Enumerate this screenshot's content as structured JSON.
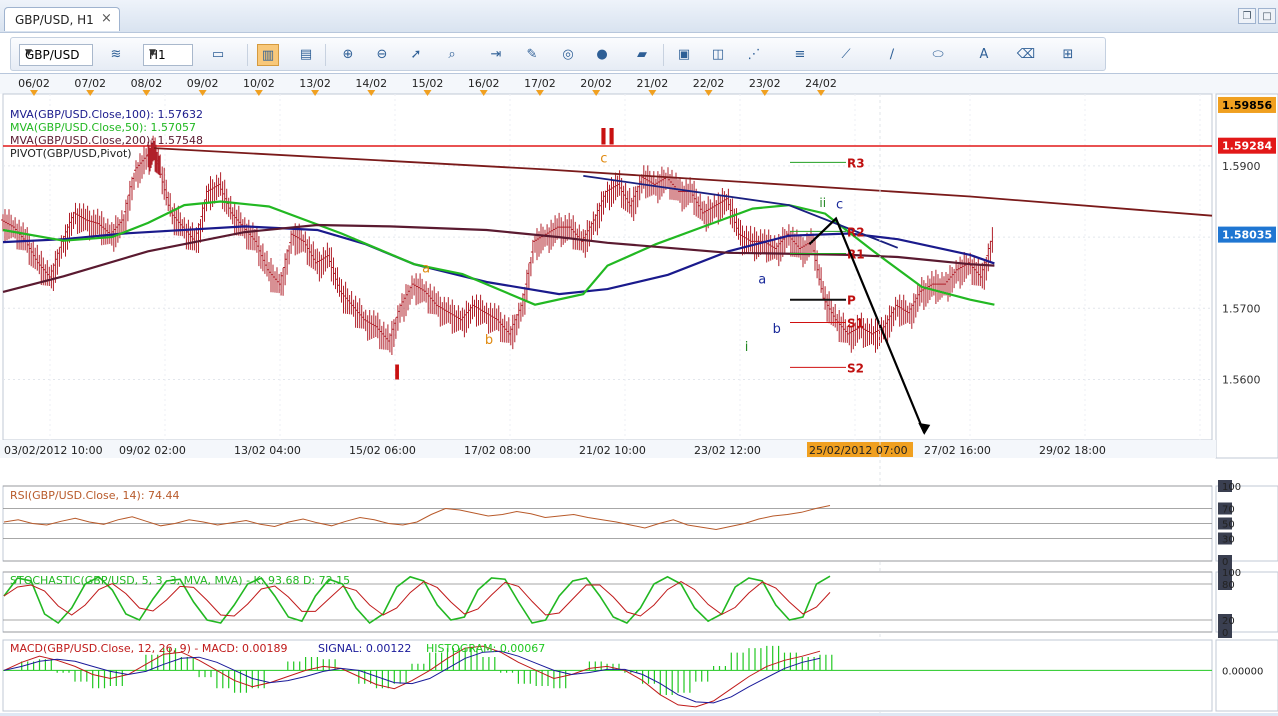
{
  "window": {
    "tab_label": "GBP/USD, H1",
    "close_icon": "×",
    "restore_icon": "❐",
    "maximize_icon": "□"
  },
  "toolbar": {
    "symbol": "GBP/USD",
    "timeframe": "H1",
    "icons": [
      "bar-chart-icon",
      "tick-icon",
      "candle-chart-icon",
      "line-chart-icon",
      "zoom-in-icon",
      "zoom-out-icon",
      "cursor-icon",
      "zoom-area-icon",
      "autoscroll-icon",
      "add-indicator-icon",
      "crosshair-icon",
      "globe-icon",
      "ruler-icon",
      "screenshot-icon",
      "templates-icon",
      "fibonacci-icon",
      "hline-icon",
      "trendline-icon",
      "pen-icon",
      "ellipse-icon",
      "text-icon",
      "eraser-icon",
      "sitemap-icon"
    ]
  },
  "chart_data": {
    "main": {
      "type": "line",
      "symbol": "GBP/USD",
      "ylim": [
        1.5515,
        1.6001
      ],
      "y_ticks": [
        1.56,
        1.57,
        1.58,
        1.59
      ],
      "top_date_labels": [
        "06/02",
        "07/02",
        "08/02",
        "09/02",
        "10/02",
        "13/02",
        "14/02",
        "15/02",
        "16/02",
        "17/02",
        "20/02",
        "21/02",
        "22/02",
        "23/02",
        "24/02"
      ],
      "bottom_time_labels": [
        "03/02/2012 10:00",
        "09/02 02:00",
        "13/02 04:00",
        "15/02 06:00",
        "17/02 08:00",
        "21/02 10:00",
        "23/02 12:00",
        "25/02/2012 07:00",
        "27/02 16:00",
        "29/02 18:00"
      ],
      "price_tags": [
        {
          "value": "1.59856",
          "color": "#f0a020"
        },
        {
          "value": "1.59284",
          "color": "#e21818"
        },
        {
          "value": "1.58035",
          "color": "#1f76d2"
        }
      ],
      "legend": [
        {
          "text": "MVA(GBP/USD.Close,100): 1.57632",
          "color": "#1a1a8c"
        },
        {
          "text": "MVA(GBP/USD.Close,50): 1.57057",
          "color": "#22b822"
        },
        {
          "text": "MVA(GBP/USD.Close,200): 1.57548",
          "color": "#5a1a30"
        },
        {
          "text": "PIVOT(GBP/USD,Pivot)",
          "color": "#222222"
        }
      ],
      "resistance_level": 1.5928,
      "pivot_levels": [
        {
          "name": "R3",
          "value": 1.5905,
          "color": "#22a022"
        },
        {
          "name": "R2",
          "value": 1.5808,
          "color": "#22a022"
        },
        {
          "name": "R1",
          "value": 1.5777,
          "color": "#22a022"
        },
        {
          "name": "P",
          "value": 1.5712,
          "color": "#111111"
        },
        {
          "name": "S1",
          "value": 1.568,
          "color": "#d01010"
        },
        {
          "name": "S2",
          "value": 1.5617,
          "color": "#d01010"
        }
      ],
      "wave_labels": [
        {
          "text": "II",
          "color": "#c81010"
        },
        {
          "text": "I",
          "color": "#c81010"
        },
        {
          "text": "a",
          "color": "#e08a10"
        },
        {
          "text": "b",
          "color": "#e08a10"
        },
        {
          "text": "c",
          "color": "#e08a10"
        },
        {
          "text": "a",
          "color": "#1a2a9a"
        },
        {
          "text": "b",
          "color": "#1a2a9a"
        },
        {
          "text": "c",
          "color": "#1a2a9a"
        },
        {
          "text": "i",
          "color": "#228822"
        },
        {
          "text": "ii",
          "color": "#228822"
        }
      ],
      "series": [
        {
          "name": "MVA(GBP/USD.Close,100)",
          "color": "#1a1a8c",
          "x": [
            0,
            0.05,
            0.1,
            0.2,
            0.26,
            0.3,
            0.34,
            0.4,
            0.46,
            0.5,
            0.55,
            0.6,
            0.65,
            0.7,
            0.74,
            0.8,
            0.82
          ],
          "values": [
            1.5793,
            1.5797,
            1.5805,
            1.5815,
            1.581,
            1.579,
            1.5762,
            1.5737,
            1.572,
            1.5727,
            1.5747,
            1.578,
            1.5802,
            1.5805,
            1.5797,
            1.5775,
            1.5763
          ]
        },
        {
          "name": "MVA(GBP/USD.Close,50)",
          "color": "#22b822",
          "x": [
            0,
            0.05,
            0.09,
            0.12,
            0.15,
            0.18,
            0.22,
            0.28,
            0.34,
            0.38,
            0.44,
            0.48,
            0.5,
            0.54,
            0.58,
            0.62,
            0.65,
            0.68,
            0.72,
            0.76,
            0.8,
            0.82
          ],
          "values": [
            1.581,
            1.5795,
            1.58,
            1.582,
            1.5845,
            1.585,
            1.5843,
            1.5805,
            1.5762,
            1.5748,
            1.5705,
            1.572,
            1.576,
            1.579,
            1.5815,
            1.584,
            1.5845,
            1.5833,
            1.578,
            1.573,
            1.5712,
            1.5705
          ]
        },
        {
          "name": "MVA(GBP/USD.Close,200)",
          "color": "#5a1a30",
          "x": [
            0,
            0.05,
            0.12,
            0.2,
            0.26,
            0.32,
            0.4,
            0.46,
            0.5,
            0.55,
            0.6,
            0.64,
            0.7,
            0.74,
            0.8,
            0.82
          ],
          "values": [
            1.5723,
            1.5745,
            1.578,
            1.5807,
            1.5817,
            1.5815,
            1.581,
            1.58,
            1.5792,
            1.5785,
            1.5778,
            1.5777,
            1.5775,
            1.5772,
            1.5762,
            1.576
          ]
        },
        {
          "name": "Downtrend line",
          "color": "#7a1a1a",
          "x": [
            0.125,
            0.45,
            0.8,
            1.0
          ],
          "values": [
            1.5925,
            1.5895,
            1.5857,
            1.583
          ]
        },
        {
          "name": "Blue trendline",
          "color": "#1a2080",
          "x": [
            0.48,
            0.65,
            0.74
          ],
          "values": [
            1.5886,
            1.5845,
            1.5785
          ]
        }
      ],
      "price_series": {
        "x": [
          0,
          0.01,
          0.02,
          0.03,
          0.04,
          0.05,
          0.06,
          0.07,
          0.08,
          0.09,
          0.1,
          0.11,
          0.12,
          0.125,
          0.13,
          0.14,
          0.15,
          0.16,
          0.17,
          0.18,
          0.19,
          0.2,
          0.21,
          0.22,
          0.23,
          0.24,
          0.25,
          0.26,
          0.27,
          0.28,
          0.29,
          0.3,
          0.31,
          0.32,
          0.33,
          0.34,
          0.35,
          0.36,
          0.37,
          0.38,
          0.39,
          0.4,
          0.41,
          0.42,
          0.43,
          0.44,
          0.45,
          0.46,
          0.47,
          0.48,
          0.49,
          0.5,
          0.51,
          0.52,
          0.53,
          0.54,
          0.55,
          0.56,
          0.57,
          0.58,
          0.59,
          0.6,
          0.61,
          0.62,
          0.63,
          0.64,
          0.65,
          0.66,
          0.67,
          0.68,
          0.69,
          0.7,
          0.71,
          0.72,
          0.73,
          0.74,
          0.75,
          0.76,
          0.77,
          0.78,
          0.79,
          0.8,
          0.81,
          0.82
        ],
        "values": [
          1.582,
          1.581,
          1.579,
          1.576,
          1.574,
          1.579,
          1.583,
          1.582,
          1.5815,
          1.58,
          1.582,
          1.589,
          1.591,
          1.592,
          1.5895,
          1.583,
          1.581,
          1.579,
          1.586,
          1.587,
          1.583,
          1.581,
          1.579,
          1.575,
          1.573,
          1.58,
          1.579,
          1.576,
          1.577,
          1.572,
          1.57,
          1.568,
          1.567,
          1.565,
          1.57,
          1.573,
          1.572,
          1.57,
          1.569,
          1.568,
          1.57,
          1.569,
          1.568,
          1.566,
          1.57,
          1.579,
          1.58,
          1.581,
          1.581,
          1.579,
          1.582,
          1.586,
          1.587,
          1.584,
          1.588,
          1.587,
          1.588,
          1.586,
          1.586,
          1.583,
          1.584,
          1.585,
          1.58,
          1.579,
          1.579,
          1.578,
          1.58,
          1.578,
          1.579,
          1.571,
          1.568,
          1.566,
          1.567,
          1.566,
          1.567,
          1.57,
          1.569,
          1.572,
          1.573,
          1.573,
          1.575,
          1.576,
          1.574,
          1.58
        ]
      }
    },
    "rsi": {
      "type": "line",
      "label": "RSI(GBP/USD.Close, 14): 74.44",
      "color": "#b85a2a",
      "ylim": [
        0,
        100
      ],
      "ticks": [
        0,
        30,
        50,
        70,
        100
      ],
      "values": [
        52,
        55,
        50,
        48,
        53,
        57,
        52,
        49,
        55,
        59,
        53,
        47,
        50,
        55,
        52,
        48,
        51,
        54,
        49,
        46,
        52,
        56,
        51,
        47,
        53,
        58,
        55,
        50,
        48,
        52,
        62,
        70,
        68,
        64,
        60,
        62,
        66,
        63,
        58,
        60,
        62,
        58,
        55,
        52,
        48,
        44,
        50,
        55,
        48,
        45,
        42,
        46,
        50,
        56,
        60,
        62,
        65,
        70,
        74
      ]
    },
    "stochastic": {
      "type": "line",
      "label": "STOCHASTIC(GBP/USD, 5, 3, 3, MVA, MVA) -  K: 93.68   D: 72.15",
      "k_color": "#22b822",
      "d_color": "#c01a1a",
      "ylim": [
        0,
        100
      ],
      "ticks": [
        0,
        20,
        80,
        100
      ],
      "k": [
        60,
        90,
        85,
        30,
        15,
        40,
        80,
        92,
        70,
        30,
        20,
        55,
        85,
        88,
        50,
        20,
        15,
        45,
        80,
        90,
        60,
        25,
        18,
        60,
        88,
        80,
        40,
        15,
        30,
        75,
        92,
        85,
        45,
        20,
        25,
        70,
        90,
        88,
        50,
        15,
        20,
        60,
        85,
        90,
        60,
        25,
        15,
        40,
        80,
        92,
        80,
        40,
        18,
        30,
        75,
        90,
        85,
        45,
        20,
        25,
        80,
        93
      ]
    },
    "macd": {
      "type": "line",
      "label_prefix": "MACD(GBP/USD.Close, 12, 26, 9) -  MACD: 0.00189",
      "signal_label": "SIGNAL: 0.00122",
      "hist_label": "HISTOGRAM: 0.00067",
      "macd_color": "#c01a1a",
      "signal_color": "#1a1a9a",
      "hist_color": "#22c822",
      "zero_label": "0.00000",
      "macd": [
        0.0,
        0.0008,
        0.0014,
        0.001,
        0.0004,
        -0.0004,
        -0.0008,
        -0.0004,
        0.0006,
        0.0016,
        0.0018,
        0.001,
        0.0,
        -0.001,
        -0.0016,
        -0.0012,
        -0.0006,
        0.0,
        0.0004,
        0.0002,
        -0.0006,
        -0.0014,
        -0.0018,
        -0.001,
        0.0,
        0.0012,
        0.0022,
        0.0024,
        0.0018,
        0.0008,
        0.0,
        -0.0008,
        -0.0004,
        0.0002,
        0.0004,
        0.0,
        -0.001,
        -0.0024,
        -0.0034,
        -0.0036,
        -0.003,
        -0.0018,
        -0.0006,
        0.0004,
        0.001,
        0.0014,
        0.0019
      ],
      "signal": [
        0.0,
        0.0004,
        0.0009,
        0.0011,
        0.0009,
        0.0004,
        -0.0001,
        -0.0004,
        -0.0001,
        0.0006,
        0.0012,
        0.0013,
        0.0008,
        0.0,
        -0.0008,
        -0.0012,
        -0.001,
        -0.0006,
        -0.0001,
        0.0002,
        0.0,
        -0.0006,
        -0.0012,
        -0.0013,
        -0.0008,
        0.0002,
        0.0012,
        0.0018,
        0.0019,
        0.0014,
        0.0007,
        0.0,
        -0.0004,
        -0.0002,
        0.0001,
        0.0001,
        -0.0004,
        -0.0013,
        -0.0024,
        -0.0031,
        -0.0032,
        -0.0026,
        -0.0016,
        -0.0007,
        0.0002,
        0.0008,
        0.0012
      ]
    }
  }
}
